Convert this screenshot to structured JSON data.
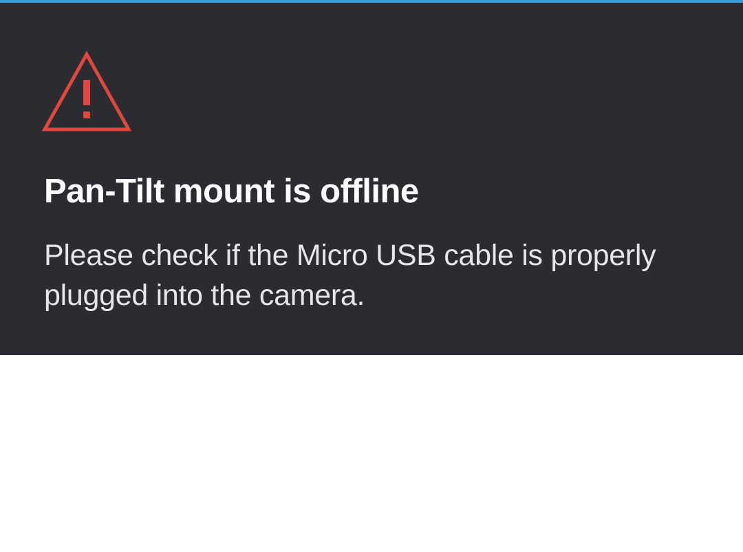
{
  "colors": {
    "accent_bar": "#3a9fd6",
    "card_background": "#2a2c31",
    "warning_icon": "#e2473f",
    "title_text": "#ffffff",
    "message_text": "#e6e6e6",
    "page_background": "#ffffff"
  },
  "alert": {
    "icon": "warning-triangle-icon",
    "title": "Pan-Tilt mount is offline",
    "message_line_1": "Please check if the Micro USB cable is properly",
    "message_line_2": "plugged into the camera."
  }
}
